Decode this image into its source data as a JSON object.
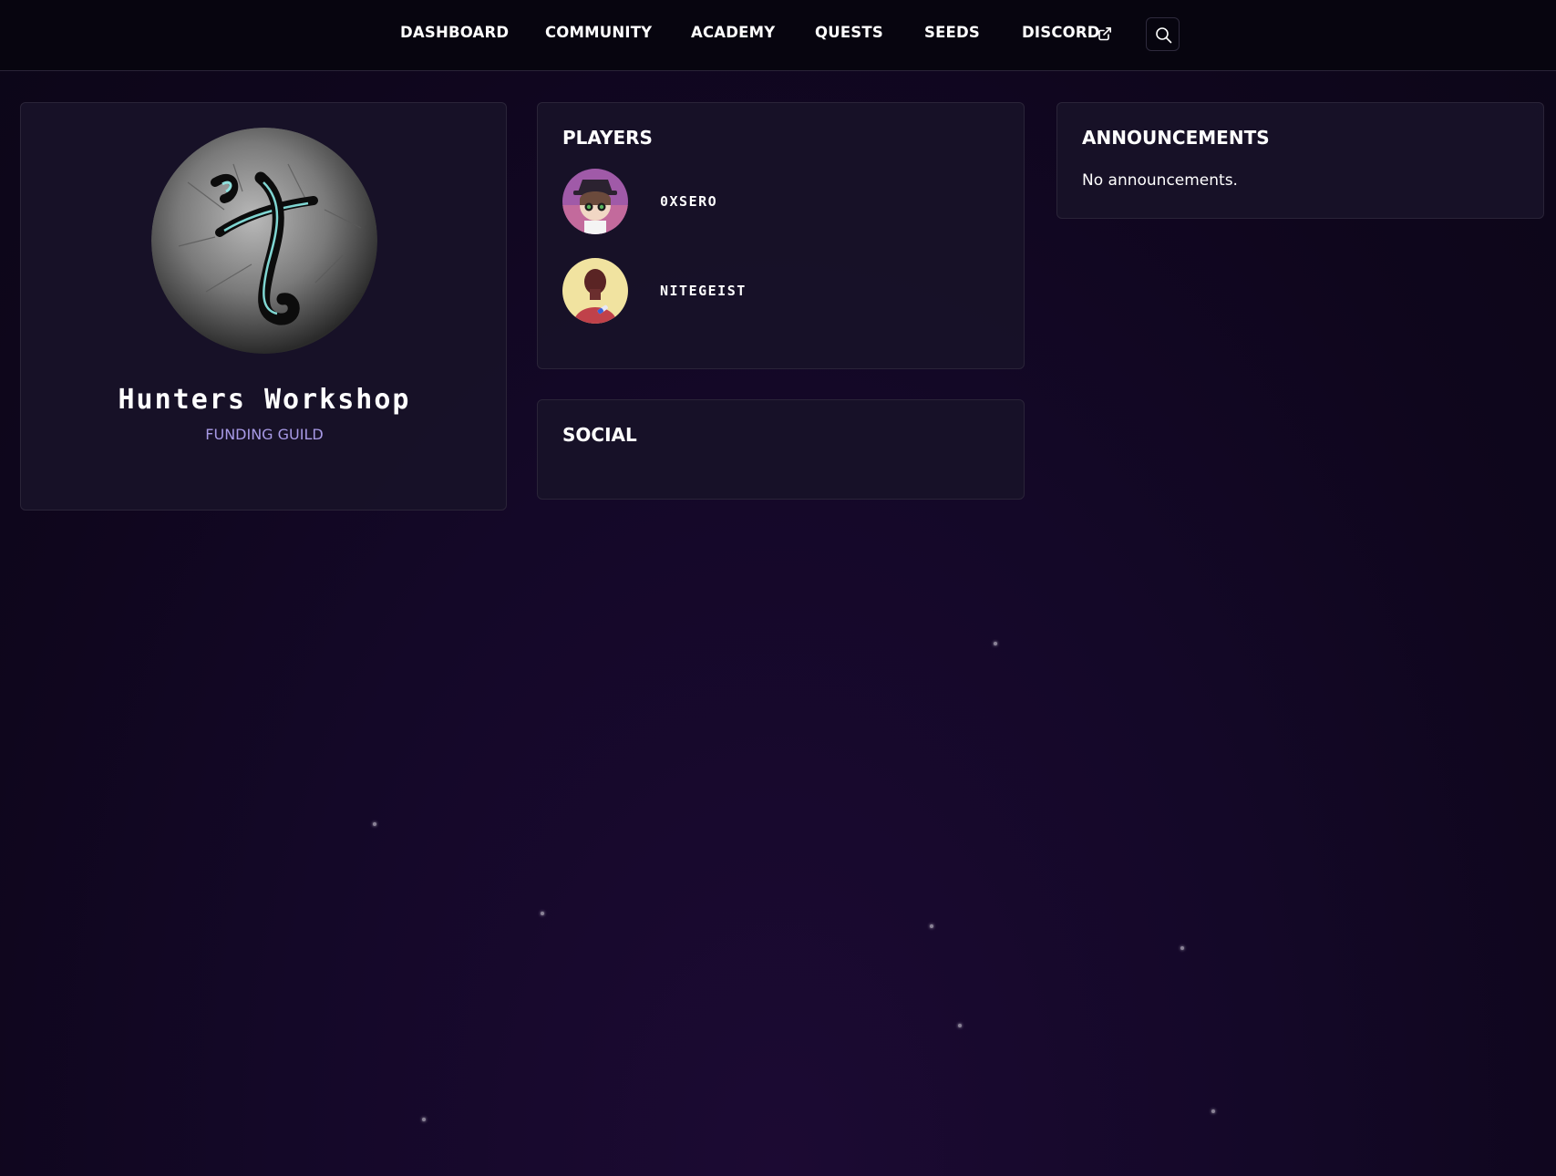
{
  "nav": {
    "items": [
      {
        "label": "DASHBOARD"
      },
      {
        "label": "COMMUNITY"
      },
      {
        "label": "ACADEMY"
      },
      {
        "label": "QUESTS"
      },
      {
        "label": "SEEDS"
      },
      {
        "label": "DISCORD",
        "icon": "external-link-icon"
      }
    ],
    "search_icon": "search-icon"
  },
  "guild": {
    "name": "Hunters Workshop",
    "type": "FUNDING GUILD",
    "avatar_icon": "guild-logo"
  },
  "players": {
    "title": "PLAYERS",
    "items": [
      {
        "name": "0XSERO",
        "avatar": "player-avatar-0xsero"
      },
      {
        "name": "NITEGEIST",
        "avatar": "player-avatar-nitegeist"
      }
    ]
  },
  "social": {
    "title": "SOCIAL"
  },
  "announcements": {
    "title": "ANNOUNCEMENTS",
    "empty_text": "No announcements."
  },
  "colors": {
    "nav_background": "#07050f",
    "page_background": "#100720",
    "card_background": "#181228",
    "guild_type_text": "#a89ae6",
    "text": "#ffffff"
  }
}
